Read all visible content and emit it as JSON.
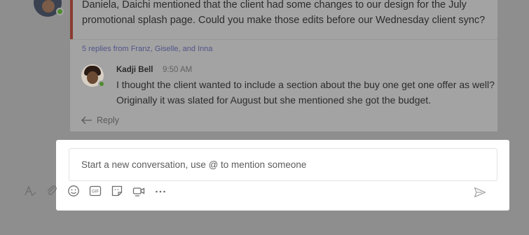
{
  "thread": {
    "parent_message_line1": "Daniela, Daichi mentioned that the client had some changes to our design for the July",
    "parent_message_line2": "promotional splash page. Could you make those edits before our Wednesday client sync?",
    "replies_summary": "5 replies from Franz, Giselle, and Inna",
    "reply": {
      "author": "Kadji Bell",
      "time": "9:50 AM",
      "text": "I thought the client wanted to include a section about the buy one get one offer as well? Originally it was slated for August but she mentioned she got the budget."
    },
    "reply_action_label": "Reply"
  },
  "compose": {
    "placeholder": "Start a new conversation, use @ to mention someone",
    "gif_label": "GIF"
  },
  "colors": {
    "accent": "#8a3b2f",
    "presence_available": "#4e8a2e",
    "link": "#51558a"
  }
}
